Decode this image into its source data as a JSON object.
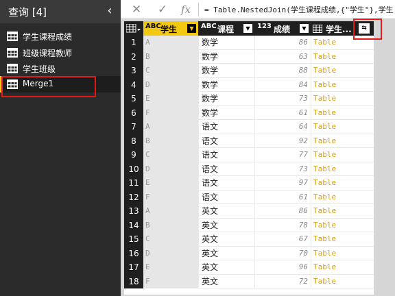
{
  "sidebar": {
    "title": "查询 [4]",
    "collapse_icon": "‹",
    "items": [
      {
        "label": "学生课程成绩",
        "icon": "table-icon"
      },
      {
        "label": "班级课程教师",
        "icon": "table-icon"
      },
      {
        "label": "学生班级",
        "icon": "table-icon"
      },
      {
        "label": "Merge1",
        "icon": "table-icon",
        "selected": true
      }
    ]
  },
  "formula_bar": {
    "cancel_icon": "✕",
    "commit_icon": "✓",
    "fx_label": "fx",
    "formula": "= Table.NestedJoin(学生课程成绩,{\"学生\"},学生"
  },
  "grid": {
    "columns": [
      {
        "type_icon": "ABC",
        "label": "学生"
      },
      {
        "type_icon": "ABC",
        "label": "课程"
      },
      {
        "type_icon": "123",
        "label": "成绩"
      },
      {
        "type_icon": "table",
        "label": "学生..."
      }
    ],
    "expand_icon": "⇆",
    "rows": [
      {
        "n": "1",
        "stu": "A",
        "course": "数学",
        "score": "86",
        "t": "Table"
      },
      {
        "n": "2",
        "stu": "B",
        "course": "数学",
        "score": "63",
        "t": "Table"
      },
      {
        "n": "3",
        "stu": "C",
        "course": "数学",
        "score": "88",
        "t": "Table"
      },
      {
        "n": "4",
        "stu": "D",
        "course": "数学",
        "score": "84",
        "t": "Table"
      },
      {
        "n": "5",
        "stu": "E",
        "course": "数学",
        "score": "73",
        "t": "Table"
      },
      {
        "n": "6",
        "stu": "F",
        "course": "数学",
        "score": "61",
        "t": "Table"
      },
      {
        "n": "7",
        "stu": "A",
        "course": "语文",
        "score": "64",
        "t": "Table"
      },
      {
        "n": "8",
        "stu": "B",
        "course": "语文",
        "score": "92",
        "t": "Table"
      },
      {
        "n": "9",
        "stu": "C",
        "course": "语文",
        "score": "77",
        "t": "Table"
      },
      {
        "n": "10",
        "stu": "D",
        "course": "语文",
        "score": "73",
        "t": "Table"
      },
      {
        "n": "11",
        "stu": "E",
        "course": "语文",
        "score": "97",
        "t": "Table"
      },
      {
        "n": "12",
        "stu": "F",
        "course": "语文",
        "score": "61",
        "t": "Table"
      },
      {
        "n": "13",
        "stu": "A",
        "course": "英文",
        "score": "86",
        "t": "Table"
      },
      {
        "n": "14",
        "stu": "B",
        "course": "英文",
        "score": "78",
        "t": "Table"
      },
      {
        "n": "15",
        "stu": "C",
        "course": "英文",
        "score": "67",
        "t": "Table"
      },
      {
        "n": "16",
        "stu": "D",
        "course": "英文",
        "score": "70",
        "t": "Table"
      },
      {
        "n": "17",
        "stu": "E",
        "course": "英文",
        "score": "96",
        "t": "Table"
      },
      {
        "n": "18",
        "stu": "F",
        "course": "英文",
        "score": "72",
        "t": "Table"
      }
    ]
  },
  "colors": {
    "accent": "#f2c811",
    "highlight_box": "#e21a1a",
    "table_link": "#d8a017"
  }
}
